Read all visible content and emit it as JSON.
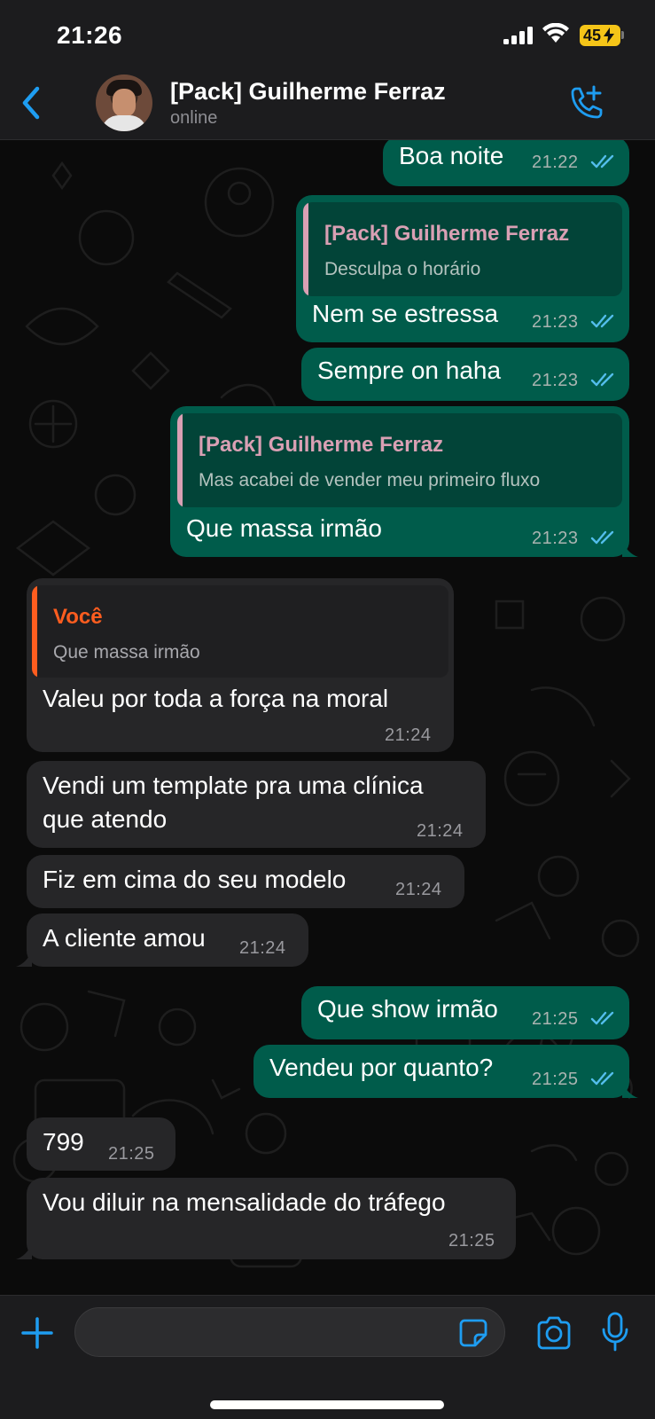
{
  "status_bar": {
    "time": "21:26",
    "battery": "45"
  },
  "header": {
    "contact_name": "[Pack] Guilherme Ferraz",
    "status": "online"
  },
  "messages": [
    {
      "dir": "out",
      "text": "Boa noite",
      "time": "21:22"
    },
    {
      "dir": "out",
      "quote_name": "[Pack] Guilherme Ferraz",
      "quote_text": "Desculpa o horário",
      "text": "Nem se estressa",
      "time": "21:23"
    },
    {
      "dir": "out",
      "text": "Sempre on haha",
      "time": "21:23"
    },
    {
      "dir": "out",
      "quote_name": "[Pack] Guilherme Ferraz",
      "quote_text": "Mas acabei de vender meu primeiro fluxo",
      "text": "Que massa irmão",
      "time": "21:23"
    },
    {
      "dir": "in",
      "quote_name": "Você",
      "quote_text": "Que massa irmão",
      "text": "Valeu por toda a força na moral",
      "time": "21:24"
    },
    {
      "dir": "in",
      "text_line1": "Vendi um template pra uma clínica",
      "text_line2": "que atendo",
      "time": "21:24"
    },
    {
      "dir": "in",
      "text": "Fiz em cima do seu modelo",
      "time": "21:24"
    },
    {
      "dir": "in",
      "text": "A cliente amou",
      "time": "21:24"
    },
    {
      "dir": "out",
      "text": "Que show irmão",
      "time": "21:25"
    },
    {
      "dir": "out",
      "text": "Vendeu por quanto?",
      "time": "21:25"
    },
    {
      "dir": "in",
      "text": "799",
      "time": "21:25"
    },
    {
      "dir": "in",
      "text": "Vou diluir na mensalidade do tráfego",
      "time": "21:25"
    }
  ],
  "composer": {
    "placeholder": ""
  },
  "colors": {
    "outgoing_bubble": "#005c4b",
    "incoming_bubble": "#262628",
    "accent_blue": "#1e9df1",
    "read_ticks": "#53bdeb",
    "quote_pink": "#d9a0b4",
    "quote_orange": "#ff5d1f"
  },
  "icons": [
    "back-chevron-icon",
    "add-call-icon",
    "plus-icon",
    "sticker-icon",
    "camera-icon",
    "microphone-icon",
    "read-ticks-icon"
  ]
}
